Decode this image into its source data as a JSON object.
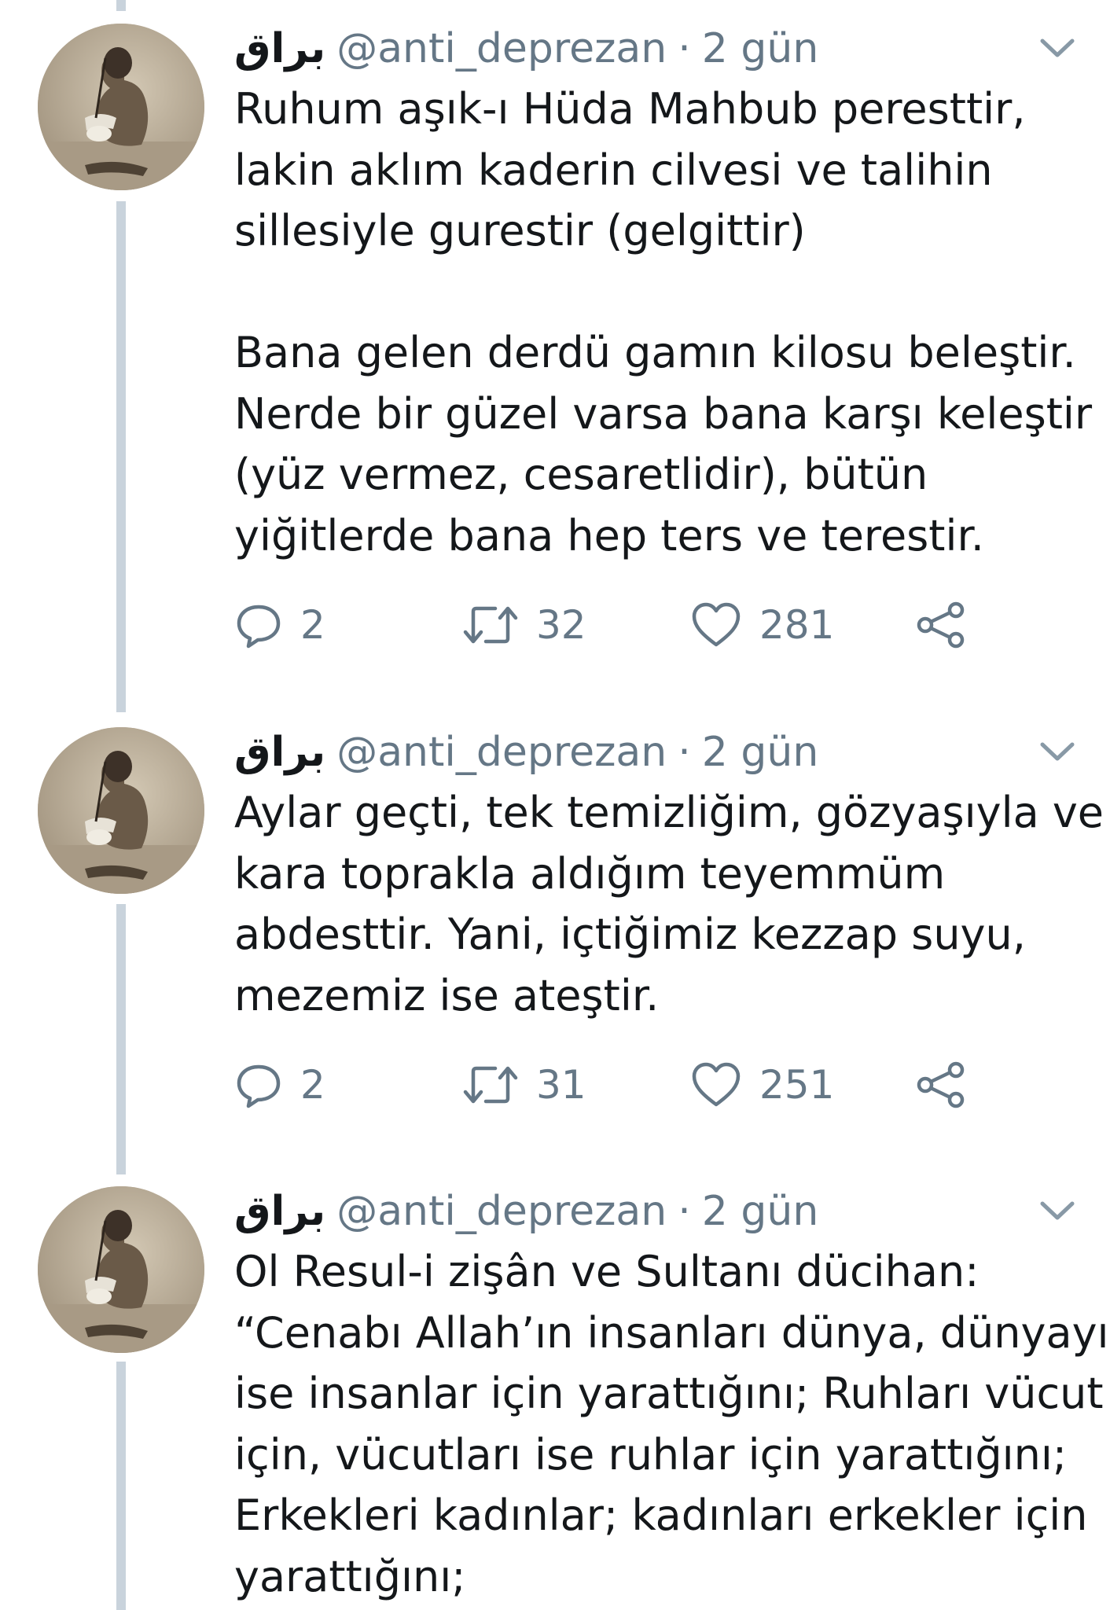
{
  "tweets": [
    {
      "display_name": "براق",
      "handle": "@anti_deprezan",
      "separator": "·",
      "time": "2 gün",
      "lines": [
        "Ruhum aşık-ı Hüda Mahbub peresttir,",
        "lakin aklım kaderin cilvesi ve talihin",
        "sillesiyle gurestir (gelgittir)",
        "",
        "Bana gelen derdü gamın kilosu beleştir.",
        "Nerde bir güzel varsa bana karşı keleştir",
        "(yüz vermez, cesaretlidir), bütün",
        "yiğitlerde bana hep ters ve terestir."
      ],
      "replies": "2",
      "retweets": "32",
      "likes": "281"
    },
    {
      "display_name": "براق",
      "handle": "@anti_deprezan",
      "separator": "·",
      "time": "2 gün",
      "lines": [
        "Aylar geçti, tek temizliğim, gözyaşıyla ve",
        "kara toprakla aldığım teyemmüm",
        "abdesttir. Yani, içtiğimiz kezzap suyu,",
        "mezemiz ise ateştir."
      ],
      "replies": "2",
      "retweets": "31",
      "likes": "251"
    },
    {
      "display_name": "براق",
      "handle": "@anti_deprezan",
      "separator": "·",
      "time": "2 gün",
      "lines": [
        "Ol Resul-i zişân ve Sultanı dücihan:",
        "“Cenabı Allah’ın insanları dünya, dünyayı",
        "ise insanlar için yarattığını; Ruhları vücut",
        "için, vücutları ise ruhlar için yarattığını;",
        "Erkekleri kadınlar; kadınları erkekler için",
        "yarattığını;"
      ]
    }
  ],
  "icons": {
    "reply": "reply-icon",
    "retweet": "retweet-icon",
    "like": "heart-icon",
    "share": "share-icon",
    "menu": "chevron-down-icon"
  },
  "colors": {
    "text": "#14171a",
    "secondary": "#657786",
    "thread_line": "#c9d3dc"
  }
}
